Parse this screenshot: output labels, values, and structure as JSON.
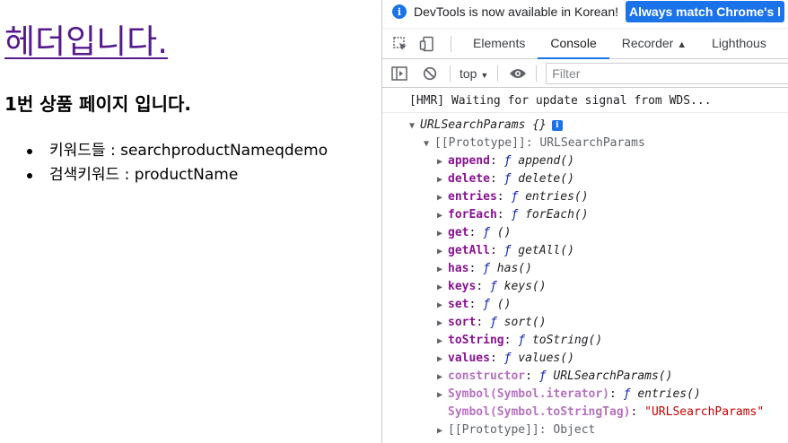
{
  "page": {
    "heading": "헤더입니다.",
    "subheading": "1번 상품 페이지 입니다.",
    "list": [
      "키워드들 : searchproductNameqdemo",
      "검색키워드 : productName"
    ]
  },
  "devtools": {
    "infobar": {
      "text": "DevTools is now available in Korean!",
      "button": "Always match Chrome's l"
    },
    "tabs": [
      "Elements",
      "Console",
      "Recorder",
      "Lighthous"
    ],
    "active_tab": "Console",
    "toolbar": {
      "context": "top",
      "filter_placeholder": "Filter"
    },
    "console": {
      "hmr": "[HMR] Waiting for update signal from WDS...",
      "object_name": "URLSearchParams {}",
      "prototype_label": "[[Prototype]]: URLSearchParams",
      "methods": [
        {
          "key": "append",
          "value": "append()"
        },
        {
          "key": "delete",
          "value": "delete()"
        },
        {
          "key": "entries",
          "value": "entries()"
        },
        {
          "key": "forEach",
          "value": "forEach()"
        },
        {
          "key": "get",
          "value": "()"
        },
        {
          "key": "getAll",
          "value": "getAll()"
        },
        {
          "key": "has",
          "value": "has()"
        },
        {
          "key": "keys",
          "value": "keys()"
        },
        {
          "key": "set",
          "value": "()"
        },
        {
          "key": "sort",
          "value": "sort()"
        },
        {
          "key": "toString",
          "value": "toString()"
        },
        {
          "key": "values",
          "value": "values()"
        },
        {
          "key": "constructor",
          "value": "URLSearchParams()"
        },
        {
          "key": "Symbol(Symbol.iterator)",
          "value": "entries()"
        }
      ],
      "tostringtag_key": "Symbol(Symbol.toStringTag)",
      "tostringtag_value": "\"URLSearchParams\"",
      "inner_prototype": "[[Prototype]]: Object"
    }
  }
}
